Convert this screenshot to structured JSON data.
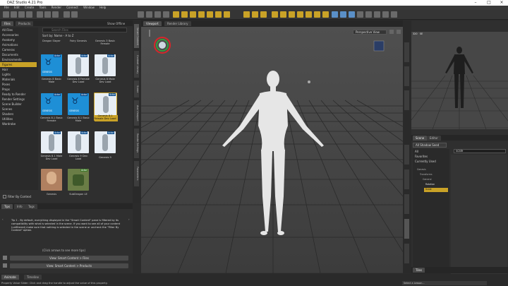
{
  "window": {
    "title": "DAZ Studio 4.21 Pro"
  },
  "menu": [
    "File",
    "Edit",
    "Create",
    "Tools",
    "Render",
    "Connect",
    "Window",
    "Help"
  ],
  "left_panel": {
    "tabs": [
      "Files",
      "Products"
    ],
    "tab_right": "Show Offline",
    "search_placeholder": "Search Files",
    "sort_label": "Sort by: Name - A to Z",
    "root_item": "All Files",
    "categories": [
      "Accessories",
      "Anatomy",
      "Animations",
      "Cameras",
      "Documents",
      "Environments",
      "Figures",
      "Hair",
      "Lights",
      "Materials",
      "Poses",
      "Props",
      "Ready to Render",
      "Render Settings",
      "Scene Builder",
      "Scenes",
      "Shaders",
      "Utilities",
      "Wardrobe"
    ],
    "selected_category": "Figures",
    "items": [
      {
        "cap": "Dragon Slayer",
        "badge": ""
      },
      {
        "cap": "Fairy Genesis",
        "badge": ""
      },
      {
        "cap": "Genesis 3 Basic Female",
        "badge": ""
      },
      {
        "cap": "Genesis 8 Basic Male",
        "badge": "Actor"
      },
      {
        "cap": "Genesis 8 Female Dev Load",
        "badge": "Actor"
      },
      {
        "cap": "Genesis 8 Male Dev Load",
        "badge": "Actor"
      },
      {
        "cap": "Genesis 8.1 Basic Female",
        "badge": "Actor"
      },
      {
        "cap": "Genesis 8.1 Basic Male",
        "badge": "Actor"
      },
      {
        "cap": "Genesis 8.1 Female Dev Load",
        "badge": "Actor"
      },
      {
        "cap": "Genesis 8.1 Male Dev Load",
        "badge": "Actor"
      },
      {
        "cap": "Genesis 9 Dev Load",
        "badge": "Actor"
      },
      {
        "cap": "Genesis 9",
        "badge": "Actor"
      },
      {
        "cap": "Genesis",
        "badge": ""
      },
      {
        "cap": "SubDragon LE",
        "badge": "Actor"
      }
    ],
    "genesis_text": "GENESIS",
    "filter_label": "Filter By Context",
    "vtabs": [
      "Smart Content",
      "Content Library",
      "Scene",
      "Aux Viewport",
      "Render Settings",
      "Parameters"
    ]
  },
  "tips": {
    "tabs": [
      "Tips",
      "Info",
      "Tags"
    ],
    "text": "Tip 1 - By default, everything displayed in the \"Smart Content\" pane is filtered by its compatibility with what is selected in the scene. If you want to see all of your content (unfiltered) make sure that nothing is selected in the scene or uncheck the \"Filter By Context\" option.",
    "hint": "(Click arrows to see more tips)",
    "btn1": "View: Smart Content > Files",
    "btn2": "View: Smart Content > Products"
  },
  "viewport": {
    "tabs": [
      "Viewport",
      "Render Library"
    ],
    "camera": "Perspective View"
  },
  "right_panel": {
    "tabs": [
      "Scene",
      "Editor"
    ],
    "dropdown": "All Shadow Seed",
    "list": [
      "All",
      "Favorites",
      "Currently Used"
    ],
    "search": "scale",
    "tree": [
      "Genesis",
      "Transforms",
      "General",
      "Rotation",
      "Scale"
    ],
    "selected_tree": "Scale",
    "checkbox_label": "Show Sub Items",
    "bottom_tab": "Tiles"
  },
  "aux_viewport": {
    "label1": "320",
    "label2": "SE"
  },
  "status": {
    "tabs": [
      "Animate",
      "Timeline"
    ],
    "text": "Property Value Slider: Click and drag the handle to adjust the value of this property.",
    "lesson": "Select a Lesson..."
  },
  "colors": {
    "accent": "#c9a227",
    "blue": "#1e8fd6"
  }
}
